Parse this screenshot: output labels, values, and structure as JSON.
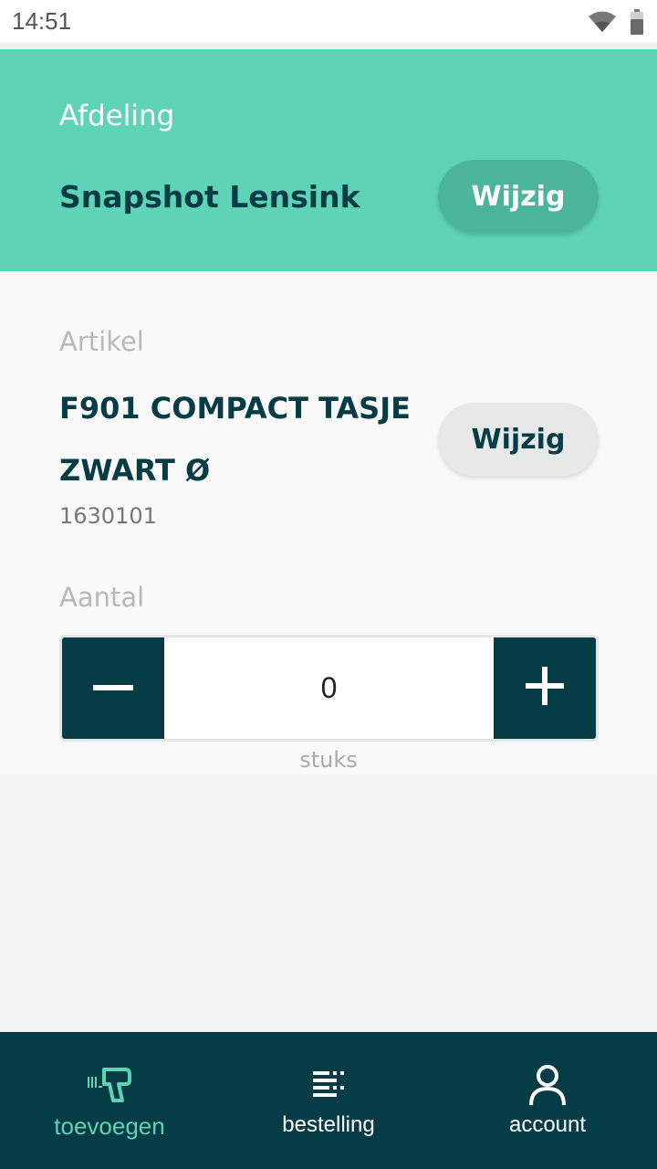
{
  "status_bar": {
    "time": "14:51",
    "icons": [
      "wifi-icon",
      "battery-icon"
    ]
  },
  "header": {
    "label": "Afdeling",
    "department": "Snapshot Lensink",
    "change_label": "Wijzig"
  },
  "article": {
    "label": "Artikel",
    "name": "F901 COMPACT TASJE ZWART Ø",
    "code": "1630101",
    "change_label": "Wijzig"
  },
  "quantity": {
    "label": "Aantal",
    "value": "0",
    "unit": "stuks",
    "minus_icon": "minus-icon",
    "plus_icon": "plus-icon"
  },
  "bottom_nav": {
    "items": [
      {
        "label": "toevoegen",
        "icon": "barcode-scanner-icon",
        "active": true
      },
      {
        "label": "bestelling",
        "icon": "order-list-icon",
        "active": false
      },
      {
        "label": "account",
        "icon": "account-icon",
        "active": false
      }
    ]
  },
  "colors": {
    "accent": "#5fd3b5",
    "dark": "#053c46",
    "header_button": "#4ab59b"
  }
}
